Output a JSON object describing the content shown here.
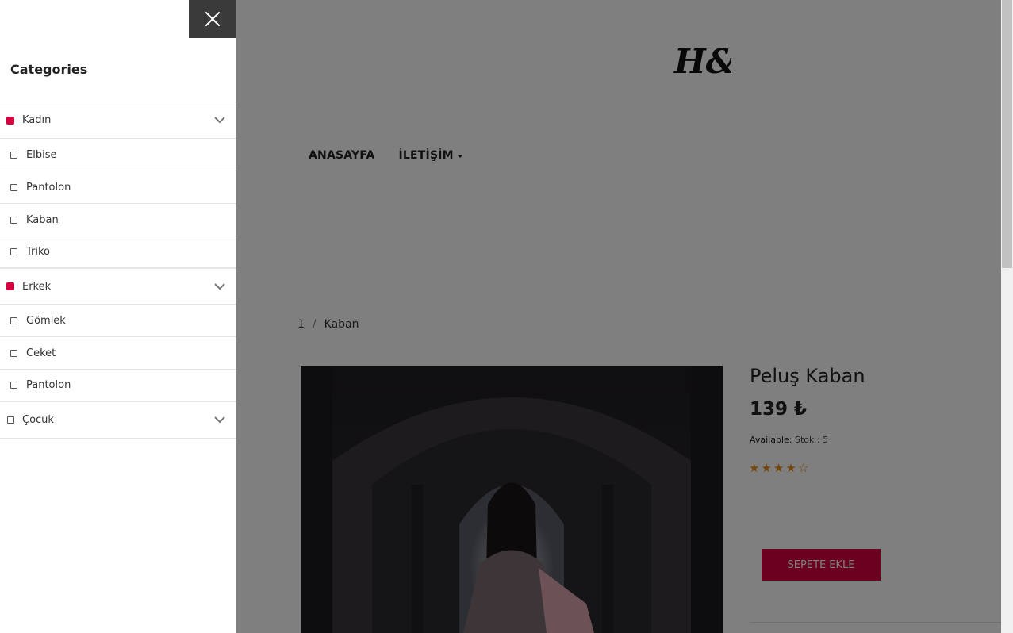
{
  "brand": {
    "logo_text": "H&M"
  },
  "nav": {
    "items": [
      {
        "label": "ANASAYFA"
      },
      {
        "label": "İLETİŞİM"
      }
    ]
  },
  "breadcrumb": {
    "items": [
      "1",
      "Kaban"
    ],
    "separator": "/"
  },
  "product": {
    "title": "Peluş Kaban",
    "price": "139 ₺",
    "availability_label": "Available:",
    "availability_value": "Stok : 5",
    "rating": 4,
    "rating_max": 5,
    "add_to_cart_label": "SEPETE EKLE"
  },
  "sidebar": {
    "title": "Categories",
    "close_icon": "close-icon",
    "categories": [
      {
        "label": "Kadın",
        "selected": true,
        "children": [
          "Elbise",
          "Pantolon",
          "Kaban",
          "Triko"
        ]
      },
      {
        "label": "Erkek",
        "selected": true,
        "children": [
          "Gömlek",
          "Ceket",
          "Pantolon"
        ]
      },
      {
        "label": "Çocuk",
        "selected": false,
        "children": []
      }
    ]
  },
  "colors": {
    "accent": "#d6003f",
    "star": "#e38b16",
    "close_bg": "#3a3a3a"
  }
}
